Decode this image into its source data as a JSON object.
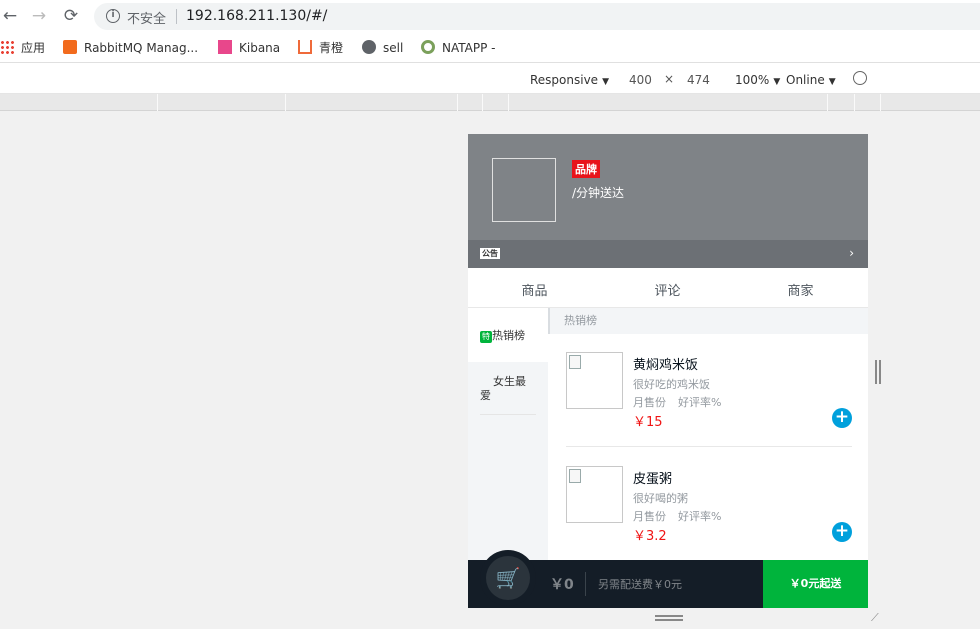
{
  "browser": {
    "insecure_label": "不安全",
    "url": "192.168.211.130/#/",
    "back_icon": "←",
    "forward_icon": "→",
    "reload_icon": "⟳"
  },
  "bookmarks": [
    {
      "label": "应用"
    },
    {
      "label": "RabbitMQ Manag..."
    },
    {
      "label": "Kibana"
    },
    {
      "label": "青橙"
    },
    {
      "label": "sell"
    },
    {
      "label": "NATAPP -"
    }
  ],
  "device_toolbar": {
    "mode": "Responsive",
    "width": "400",
    "times": "×",
    "height": "474",
    "zoom": "100%",
    "network": "Online"
  },
  "seller": {
    "brand_badge": "品牌",
    "delivery_text": "/分钟送达",
    "notice_tag": "公告",
    "notice_arrow": "›"
  },
  "tabs": [
    "商品",
    "评论",
    "商家"
  ],
  "menu": [
    {
      "icon_text": "特",
      "label": "热销榜"
    },
    {
      "label": "女生最爱"
    }
  ],
  "foods": {
    "group_title": "热销榜",
    "items": [
      {
        "name": "黄焖鸡米饭",
        "description": "很好吃的鸡米饭",
        "sell_count": "月售份",
        "rating": "好评率%",
        "price": "￥15"
      },
      {
        "name": "皮蛋粥",
        "description": "很好喝的粥",
        "sell_count": "月售份",
        "rating": "好评率%",
        "price": "￥3.2"
      }
    ]
  },
  "cart": {
    "total": "￥0",
    "delivery_fee": "另需配送费￥0元",
    "pay_label": "￥0元起送"
  },
  "colors": {
    "header_bg": "#7f8387",
    "brand_red": "#e8141b",
    "price_red": "#f01414",
    "add_blue": "#00a0dc",
    "pay_green": "#00b43c",
    "cart_bg": "#141d27"
  }
}
